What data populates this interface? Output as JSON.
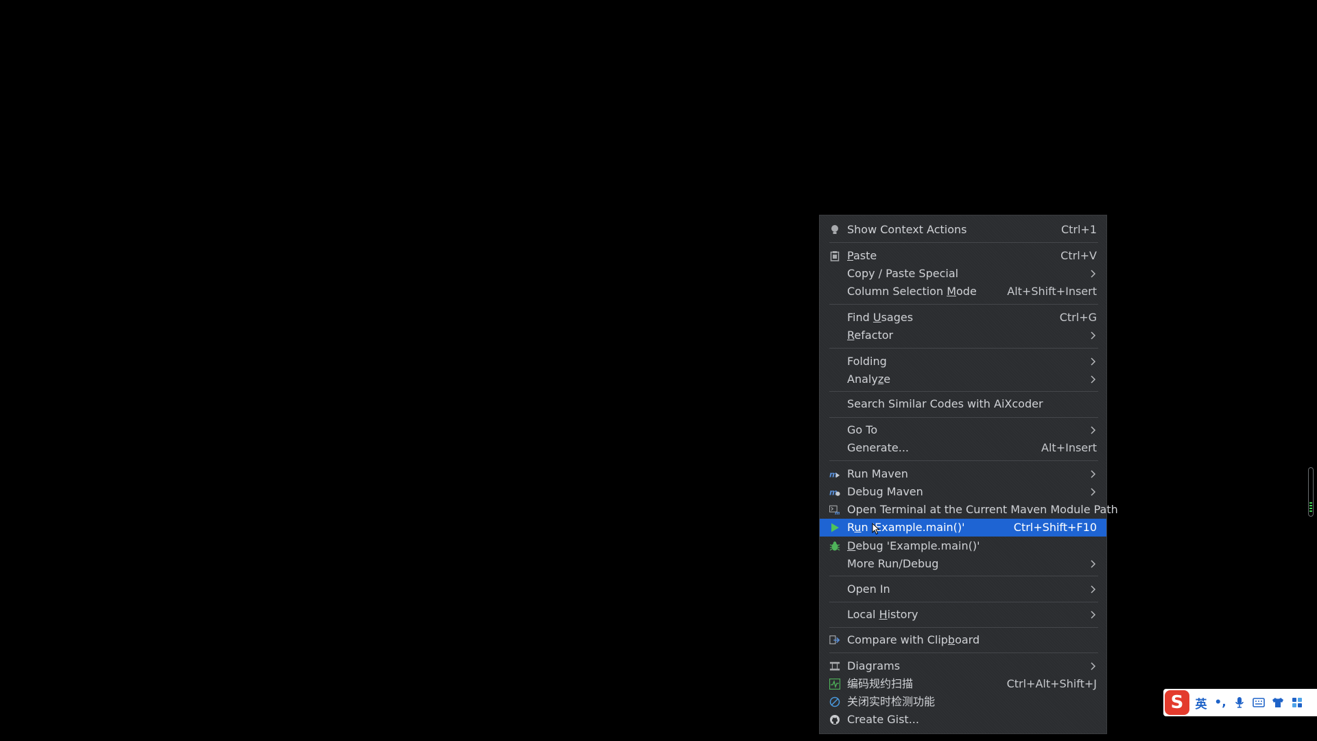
{
  "menu": {
    "show_context_actions": {
      "label": "Show Context Actions",
      "shortcut": "Ctrl+1"
    },
    "paste": {
      "label_u": "P",
      "label_rest": "aste",
      "shortcut": "Ctrl+V"
    },
    "copy_paste_special": {
      "label": "Copy / Paste Special"
    },
    "column_selection_mode": {
      "label_pre": "Column Selection ",
      "label_u": "M",
      "label_rest": "ode",
      "shortcut": "Alt+Shift+Insert"
    },
    "find_usages": {
      "label_pre": "Find ",
      "label_u": "U",
      "label_rest": "sages",
      "shortcut": "Ctrl+G"
    },
    "refactor": {
      "label_u": "R",
      "label_rest": "efactor"
    },
    "folding": {
      "label": "Folding"
    },
    "analyze": {
      "label_pre": "Analy",
      "label_u": "z",
      "label_rest": "e"
    },
    "search_similar": {
      "label": "Search Similar Codes with AiXcoder"
    },
    "go_to": {
      "label": "Go To"
    },
    "generate": {
      "label": "Generate...",
      "shortcut": "Alt+Insert"
    },
    "run_maven": {
      "label": "Run Maven"
    },
    "debug_maven": {
      "label": "Debug Maven"
    },
    "open_terminal": {
      "label": "Open Terminal at the Current Maven Module Path"
    },
    "run_example": {
      "label_pre": "R",
      "label_u": "u",
      "label_rest": "n 'Example.main()'",
      "shortcut": "Ctrl+Shift+F10"
    },
    "debug_example": {
      "label_u": "D",
      "label_rest": "ebug 'Example.main()'"
    },
    "more_run_debug": {
      "label": "More Run/Debug"
    },
    "open_in": {
      "label": "Open In"
    },
    "local_history": {
      "label_pre": "Local ",
      "label_u": "H",
      "label_rest": "istory"
    },
    "compare_clipboard": {
      "label_pre": "Compare with Clip",
      "label_u": "b",
      "label_rest": "oard"
    },
    "diagrams": {
      "label": "Diagrams"
    },
    "code_scan": {
      "label": "编码规约扫描",
      "shortcut": "Ctrl+Alt+Shift+J"
    },
    "close_realtime": {
      "label": "关闭实时检测功能"
    },
    "create_gist": {
      "label": "Create Gist..."
    }
  },
  "ime": {
    "logo": "S",
    "lang": "英",
    "punct": "•,"
  },
  "colors": {
    "menu_bg": "#2b2d30",
    "selected_bg": "#1e64d3",
    "text": "#d0d2d6"
  }
}
